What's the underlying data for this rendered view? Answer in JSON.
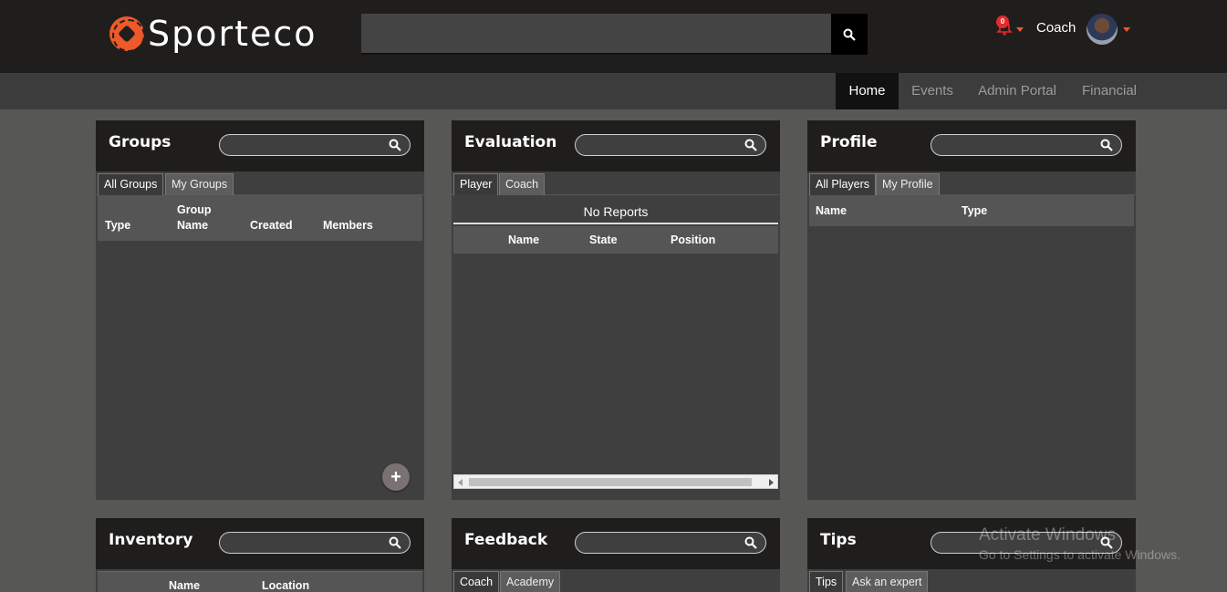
{
  "app": {
    "logo_text": "Sporteco"
  },
  "header": {
    "search_placeholder": "",
    "notification_count": "0",
    "user_role": "Coach"
  },
  "nav": {
    "items": [
      {
        "label": "Home",
        "active": true
      },
      {
        "label": "Events",
        "active": false
      },
      {
        "label": "Admin Portal",
        "active": false
      },
      {
        "label": "Financial",
        "active": false
      }
    ]
  },
  "groups": {
    "title": "Groups",
    "tabs": [
      "All Groups",
      "My Groups"
    ],
    "columns": [
      "Type",
      "Group Name",
      "Created",
      "Members"
    ]
  },
  "evaluation": {
    "title": "Evaluation",
    "tabs": [
      "Player",
      "Coach"
    ],
    "empty_message": "No Reports",
    "columns": [
      "Name",
      "State",
      "Position"
    ]
  },
  "profile": {
    "title": "Profile",
    "tabs": [
      "All Players",
      "My Profile"
    ],
    "columns": [
      "Name",
      "Type"
    ]
  },
  "inventory": {
    "title": "Inventory",
    "columns": [
      "Name",
      "Location"
    ]
  },
  "feedback": {
    "title": "Feedback",
    "tabs": [
      "Coach",
      "Academy"
    ]
  },
  "tips": {
    "title": "Tips",
    "tabs": [
      "Tips",
      "Ask an expert"
    ]
  },
  "watermark": {
    "line1": "Activate Windows",
    "line2": "Go to Settings to activate Windows."
  },
  "colors": {
    "accent": "#ed5a2a",
    "header_bg": "#1f1e1d",
    "page_bg": "#575756",
    "panel_bg": "#3f3f3f"
  }
}
